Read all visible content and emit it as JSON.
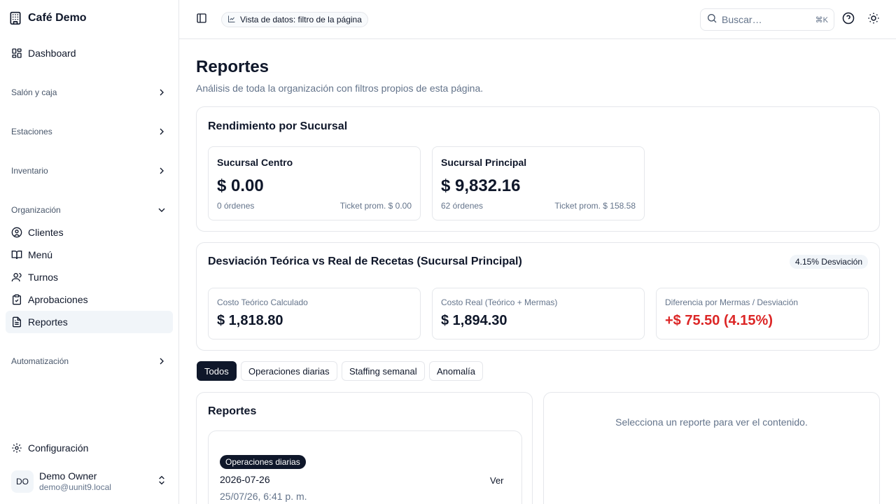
{
  "brand": {
    "name": "Café Demo",
    "icon": "building-icon"
  },
  "sidebar": {
    "dashboard": "Dashboard",
    "groups": {
      "salon": "Salón y caja",
      "estaciones": "Estaciones",
      "inventario": "Inventario",
      "organizacion": "Organización",
      "automatizacion": "Automatización"
    },
    "org_items": {
      "clientes": "Clientes",
      "menu": "Menú",
      "turnos": "Turnos",
      "aprobaciones": "Aprobaciones",
      "reportes": "Reportes"
    },
    "settings": "Configuración",
    "user": {
      "initials": "DO",
      "name": "Demo Owner",
      "email": "demo@uunit9.local"
    }
  },
  "topbar": {
    "filter_chip": "Vista de datos: filtro de la página",
    "search_placeholder": "Buscar…",
    "search_shortcut": "⌘K"
  },
  "page": {
    "title": "Reportes",
    "subtitle": "Análisis de toda la organización con filtros propios de esta página."
  },
  "branches": {
    "title": "Rendimiento por Sucursal",
    "items": [
      {
        "name": "Sucursal Centro",
        "amount": "$ 0.00",
        "orders": "0 órdenes",
        "ticket": "Ticket prom. $ 0.00"
      },
      {
        "name": "Sucursal Principal",
        "amount": "$ 9,832.16",
        "orders": "62 órdenes",
        "ticket": "Ticket prom. $ 158.58"
      }
    ]
  },
  "deviation": {
    "title": "Desviación Teórica vs Real de Recetas (Sucursal Principal)",
    "badge": "4.15% Desviación",
    "metrics": [
      {
        "label": "Costo Teórico Calculado",
        "value": "$ 1,818.80"
      },
      {
        "label": "Costo Real (Teórico + Mermas)",
        "value": "$ 1,894.30"
      },
      {
        "label": "Diferencia por Mermas / Desviación",
        "value": "+$ 75.50 (4.15%)"
      }
    ]
  },
  "tabs": [
    "Todos",
    "Operaciones diarias",
    "Staffing semanal",
    "Anomalía"
  ],
  "reports": {
    "title": "Reportes",
    "items": [
      {
        "type": "Operaciones diarias",
        "date": "2026-07-26",
        "time": "25/07/26, 6:41 p. m.",
        "action": "Ver"
      }
    ],
    "empty_message": "Selecciona un reporte para ver el contenido."
  },
  "colors": {
    "primary": "#0f172a",
    "muted": "#64748b",
    "border": "#e5e7eb",
    "negative": "#dc2626",
    "active_bg": "#f1f5f9"
  }
}
